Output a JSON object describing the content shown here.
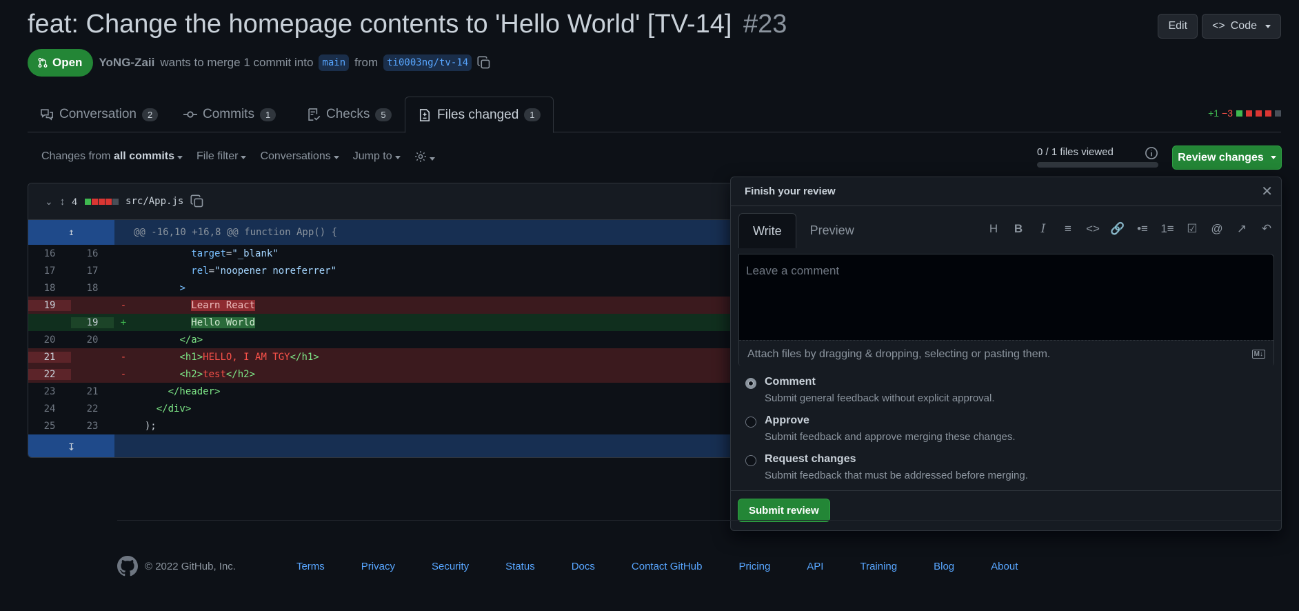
{
  "pr": {
    "title": "feat: Change the homepage contents to 'Hello World' [TV-14]",
    "number": "#23",
    "state": "Open",
    "author": "YoNG-Zaii",
    "merge_text_1": "wants to merge 1 commit into",
    "base": "main",
    "merge_text_2": "from",
    "head": "ti0003ng/tv-14"
  },
  "header_buttons": {
    "edit": "Edit",
    "code": "Code"
  },
  "tabs": [
    {
      "label": "Conversation",
      "count": "2"
    },
    {
      "label": "Commits",
      "count": "1"
    },
    {
      "label": "Checks",
      "count": "5"
    },
    {
      "label": "Files changed",
      "count": "1"
    }
  ],
  "diffstat": {
    "additions": "+1",
    "deletions": "−3"
  },
  "toolbar": {
    "changes_prefix": "Changes from",
    "changes_value": "all commits",
    "file_filter": "File filter",
    "conversations": "Conversations",
    "jump_to": "Jump to"
  },
  "files_viewed": "0 / 1 files viewed",
  "review_button": "Review changes",
  "file": {
    "changes": "4",
    "path": "src/App.js",
    "hunk": "@@ -16,10 +16,8 @@ function App() {",
    "lines": [
      {
        "old": "16",
        "new": "16",
        "sign": "",
        "type": "ctx",
        "pre": "          ",
        "code": "target=\"_blank\""
      },
      {
        "old": "17",
        "new": "17",
        "sign": "",
        "type": "ctx",
        "pre": "          ",
        "code": "rel=\"noopener noreferrer\""
      },
      {
        "old": "18",
        "new": "18",
        "sign": "",
        "type": "ctx",
        "pre": "        ",
        "code": ">"
      },
      {
        "old": "19",
        "new": "",
        "sign": "-",
        "type": "del",
        "pre": "          ",
        "code": "Learn React"
      },
      {
        "old": "",
        "new": "19",
        "sign": "+",
        "type": "add",
        "pre": "          ",
        "code": "Hello World"
      },
      {
        "old": "20",
        "new": "20",
        "sign": "",
        "type": "ctx",
        "pre": "        ",
        "code": "</a>"
      },
      {
        "old": "21",
        "new": "",
        "sign": "-",
        "type": "del",
        "pre": "        ",
        "code": "<h1>HELLO, I AM TGY</h1>"
      },
      {
        "old": "22",
        "new": "",
        "sign": "-",
        "type": "del",
        "pre": "        ",
        "code": "<h2>test</h2>"
      },
      {
        "old": "23",
        "new": "21",
        "sign": "",
        "type": "ctx",
        "pre": "      ",
        "code": "</header>"
      },
      {
        "old": "24",
        "new": "22",
        "sign": "",
        "type": "ctx",
        "pre": "    ",
        "code": "</div>"
      },
      {
        "old": "25",
        "new": "23",
        "sign": "",
        "type": "ctx",
        "pre": "  ",
        "code": ");"
      }
    ]
  },
  "review": {
    "title": "Finish your review",
    "tab_write": "Write",
    "tab_preview": "Preview",
    "placeholder": "Leave a comment",
    "attach": "Attach files by dragging & dropping, selecting or pasting them.",
    "options": [
      {
        "label": "Comment",
        "desc": "Submit general feedback without explicit approval.",
        "selected": true
      },
      {
        "label": "Approve",
        "desc": "Submit feedback and approve merging these changes.",
        "selected": false
      },
      {
        "label": "Request changes",
        "desc": "Submit feedback that must be addressed before merging.",
        "selected": false
      }
    ],
    "submit": "Submit review"
  },
  "footer": {
    "copyright": "© 2022 GitHub, Inc.",
    "links": [
      "Terms",
      "Privacy",
      "Security",
      "Status",
      "Docs",
      "Contact GitHub",
      "Pricing",
      "API",
      "Training",
      "Blog",
      "About"
    ]
  },
  "colors": {
    "accent_green": "#238636",
    "link_blue": "#58a6ff",
    "bg": "#0d1117"
  }
}
